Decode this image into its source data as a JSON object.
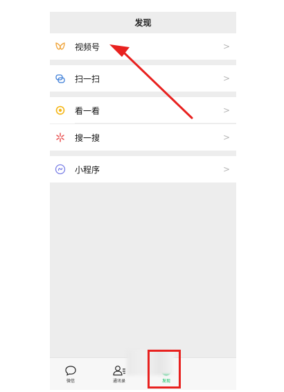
{
  "header": {
    "title": "发现"
  },
  "menu": {
    "items": [
      {
        "label": "视频号",
        "chevron": ">",
        "icon": "channels-butterfly-icon"
      },
      {
        "label": "扫一扫",
        "chevron": ">",
        "icon": "scan-icon"
      },
      {
        "label": "看一看",
        "chevron": ">",
        "icon": "top-stories-icon"
      },
      {
        "label": "搜一搜",
        "chevron": ">",
        "icon": "search-sparkle-icon"
      },
      {
        "label": "小程序",
        "chevron": ">",
        "icon": "mini-program-icon"
      }
    ]
  },
  "tabbar": {
    "tabs": [
      {
        "label": "微信",
        "icon": "chat-bubble-icon",
        "active": false
      },
      {
        "label": "通讯录",
        "icon": "contacts-icon",
        "active": false
      },
      {
        "label": "发现",
        "icon": "discover-compass-icon",
        "active": true
      }
    ]
  },
  "colors": {
    "accent": "#07c160",
    "highlight_red": "#e8211f",
    "background": "#ededed"
  }
}
